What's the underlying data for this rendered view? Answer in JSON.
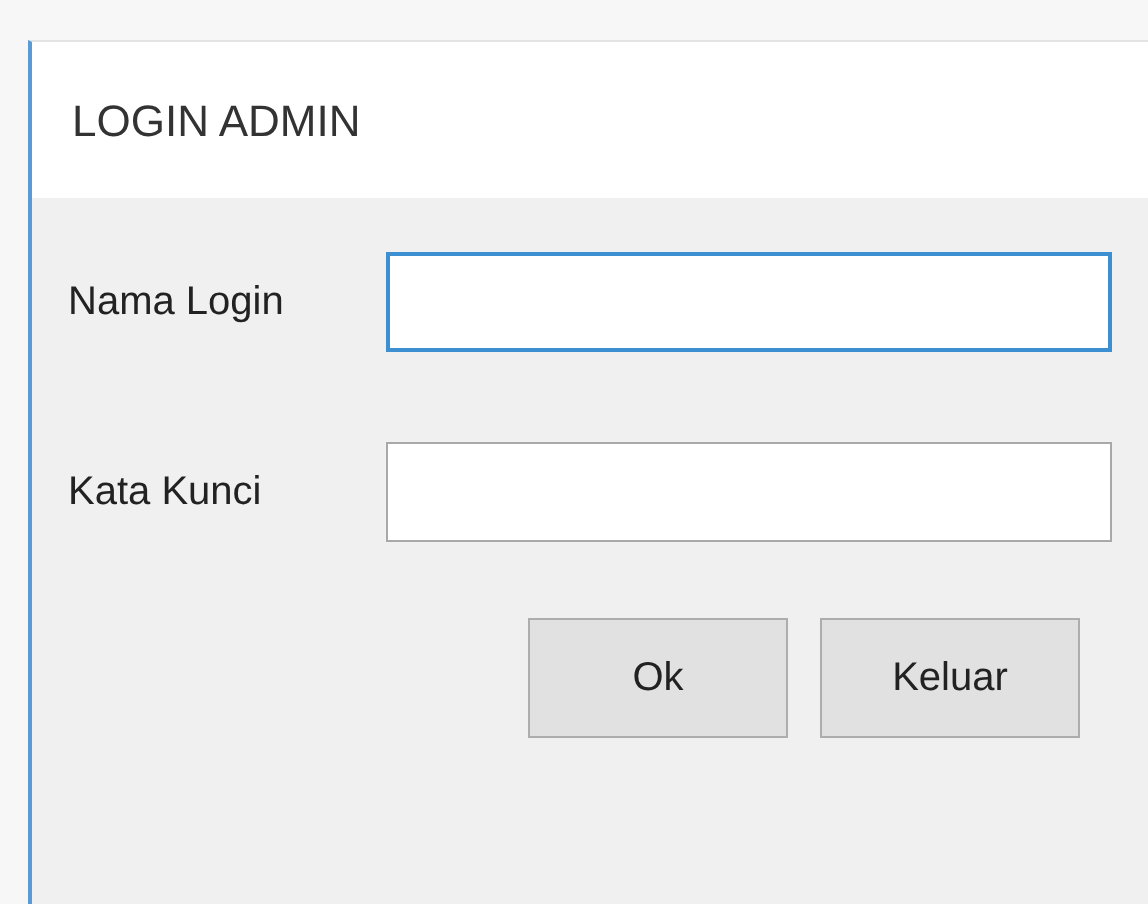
{
  "window": {
    "title": "LOGIN ADMIN"
  },
  "fields": [
    {
      "label": "Nama Login",
      "focused": true
    },
    {
      "label": "Kata Kunci",
      "focused": false
    }
  ],
  "buttons": [
    "Ok",
    "Keluar"
  ]
}
